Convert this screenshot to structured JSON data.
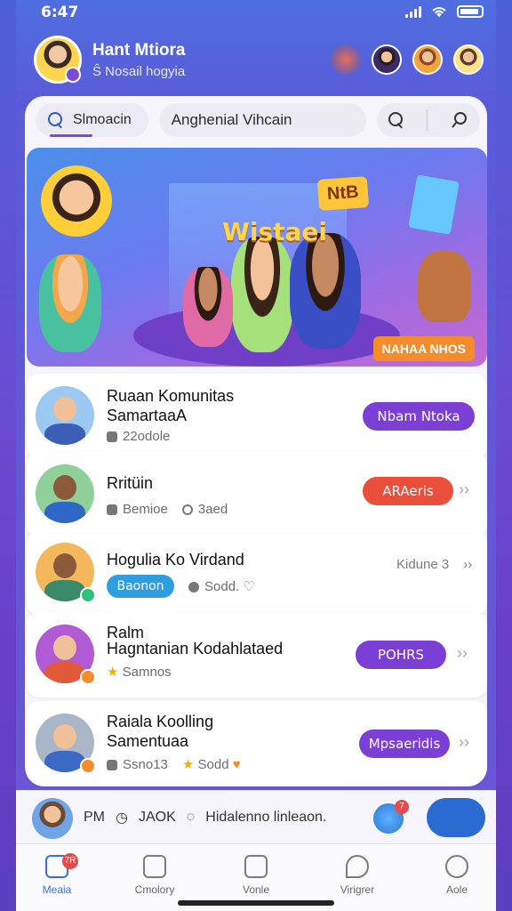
{
  "status": {
    "time": "6:47"
  },
  "profile": {
    "name": "Hant Mtiora",
    "subtitle": "Ŝ Nosail hogyia"
  },
  "search": {
    "tab_label": "Slmoacin",
    "field_value": "Anghenial Vihcain"
  },
  "banner": {
    "title": "Wistaei",
    "sign": "NtB",
    "tag": "NAHAA NHOS"
  },
  "rows": [
    {
      "title1": "Ruaan Komunitas",
      "title2": "SamartaaA",
      "meta1": "22odole",
      "button": "Nbam Ntoka",
      "button_color": "#7b3fd6"
    },
    {
      "title1": "Rritüin",
      "meta1": "Bemioe",
      "meta2": "3aed",
      "button": "ARAeris",
      "button_color": "#ea4f3b"
    },
    {
      "title1": "Hogulia Ko Virdand",
      "meta_button": "Baonon",
      "meta2": "Sodd.",
      "side_text": "Kidune 3"
    },
    {
      "title1": "Ralm",
      "title2": "Hagntanian Kodahlataed",
      "meta1": "Samnos",
      "button": "POHRS",
      "button_color": "#7b3fd6"
    },
    {
      "title1": "Raiala Koolling",
      "title2": "Samentuaa",
      "meta1": "Ssno13",
      "meta2": "Sodd",
      "button": "Mpsaeridis",
      "button_color": "#7b3fd6"
    }
  ],
  "bottom": {
    "label1": "PM",
    "label2": "JAOK",
    "label3": "Hidalenno linleaon.",
    "badge": "7"
  },
  "tabs": [
    {
      "label": "Meaia",
      "badge": "7R"
    },
    {
      "label": "Cmolory"
    },
    {
      "label": "Vonle"
    },
    {
      "label": "Virigrer"
    },
    {
      "label": "Aole"
    }
  ]
}
